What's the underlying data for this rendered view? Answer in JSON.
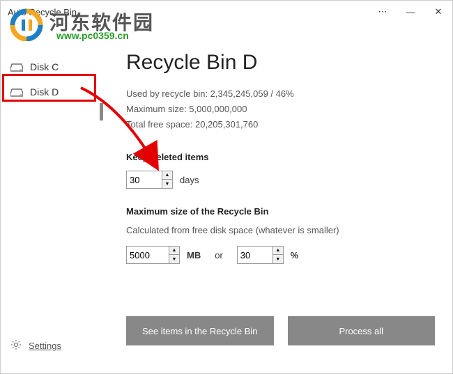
{
  "window": {
    "title": "Auto Recycle Bin"
  },
  "watermark": {
    "line1": "河东软件园",
    "line2": "www.pc0359.cn"
  },
  "sidebar": {
    "items": [
      {
        "label": "Disk C"
      },
      {
        "label": "Disk D"
      }
    ],
    "settings_label": "Settings"
  },
  "main": {
    "title": "Recycle Bin D",
    "info_used": "Used by recycle bin: 2,345,245,059 / 46%",
    "info_max": "Maximum size: 5,000,000,000",
    "info_free": "Total free space: 20,205,301,760",
    "keep_label": "Keep deleted items",
    "keep_value": "30",
    "keep_unit": "days",
    "maxsize_label": "Maximum size of the Recycle Bin",
    "maxsize_sub": "Calculated from free disk space (whatever is smaller)",
    "mb_value": "5000",
    "mb_unit": "MB",
    "or_label": "or",
    "pct_value": "30",
    "pct_unit": "%",
    "btn_see": "See items in the Recycle Bin",
    "btn_process": "Process all"
  }
}
